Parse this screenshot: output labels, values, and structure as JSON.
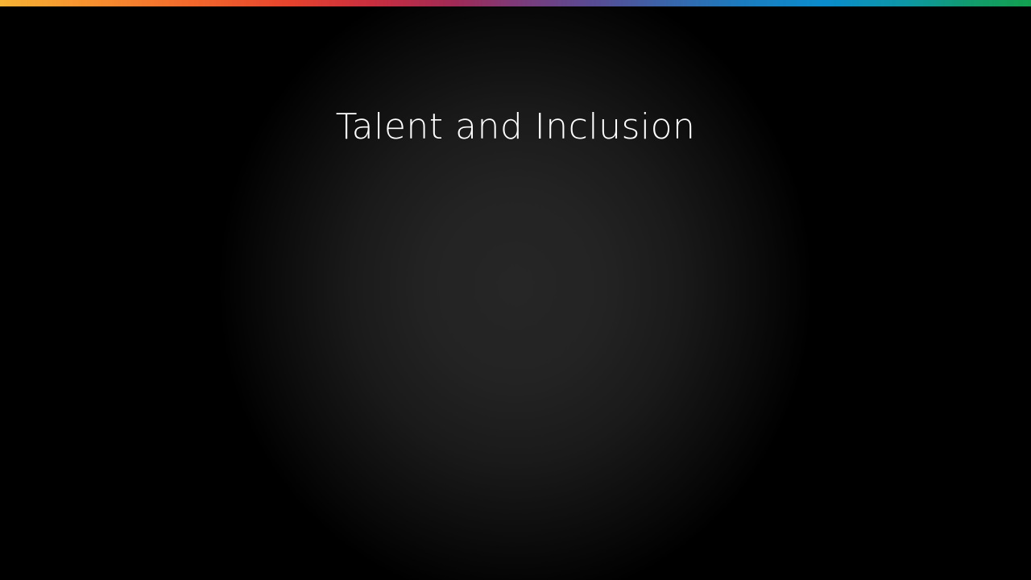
{
  "slide": {
    "title": "Talent and Inclusion"
  },
  "colors": {
    "background": "#000000",
    "vignette_center": "#262626",
    "title_text": "#ffffff",
    "accent_gradient": [
      "#f5b335",
      "#f26a2c",
      "#c92e3f",
      "#7e3a78",
      "#3d62a8",
      "#0a8ccc",
      "#12a04f"
    ]
  }
}
